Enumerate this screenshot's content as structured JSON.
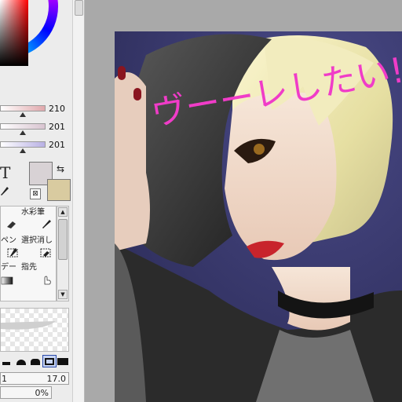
{
  "colors": {
    "panel_bg": "#ececec",
    "canvas_bg": "#a9a9a9",
    "fg_color": "#d8d2d5",
    "bg_color": "#d9cba0",
    "selection_blue": "#2a4aa8",
    "handwriting_pink": "#f03cc8"
  },
  "sliders": [
    {
      "value": "210",
      "track_from": "#ffffff",
      "track_to": "#e0a8ac"
    },
    {
      "value": "201",
      "track_from": "#ffffff",
      "track_to": "#d8c4d0"
    },
    {
      "value": "201",
      "track_from": "#ffffff",
      "track_to": "#b8b0e4"
    }
  ],
  "tools": {
    "text_tool_label": "T",
    "swap_icon": "⇆",
    "reset_icon": "⊠"
  },
  "brushes": [
    {
      "label": "",
      "icon": "eraser-icon"
    },
    {
      "label": "水彩筆",
      "icon": "watercolor-brush-icon"
    },
    {
      "label": "ペン",
      "icon": "pen-icon"
    },
    {
      "label": "選択消し",
      "icon": "selection-eraser-icon"
    },
    {
      "label": "デー",
      "icon": "gradient-icon"
    },
    {
      "label": "指先",
      "icon": "finger-icon"
    }
  ],
  "brush_size": {
    "min": "1",
    "value": "17.0"
  },
  "density": {
    "value": "0%"
  },
  "artwork": {
    "handwriting": "ヴーーレしたい!!"
  }
}
